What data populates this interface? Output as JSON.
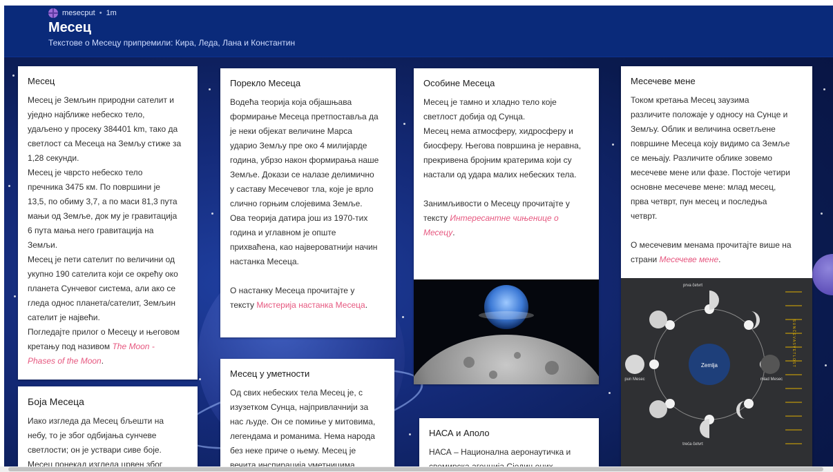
{
  "header": {
    "author": "mesecput",
    "time": "1m",
    "title": "Месец",
    "subtitle": "Текстове о Месецу припремили: Кира, Леда, Лана и Константин"
  },
  "cards": {
    "mesec": {
      "title": "Месец",
      "lines": [
        "Месец је Земљин природни сателит и",
        "уједно најближе небеско тело,",
        "удаљено у просеку 384401 km, тако да",
        "светлост са Месеца на Земљу стиже за",
        "1,28 секунди.",
        "Месец је чврсто небеско тело",
        "пречника 3475 км. По површини је",
        "13,5, по обиму 3,7, а по маси 81,3 пута",
        "мањи од Земље, док му је гравитација",
        "6 пута мања него гравитација на",
        "Земљи.",
        "Месец је пети сателит по величини од",
        "укупно 190 сателита који се окрећу око",
        "планета Сунчевог система, али ако се",
        "гледа однос планета/сателит, Земљин",
        "сателит је највећи.",
        "Погледајте прилог о Месецу и његовом",
        "кретању под називом"
      ],
      "link_a": "The Moon -",
      "link_b": "Phases of the Moon",
      "tail": "."
    },
    "boja": {
      "title": "Боја Месеца",
      "lines": [
        "Иако изгледа да Месец бљешти на",
        "небу, то је због одбијања сунчеве",
        "светлости; он је уствари сиве боје.",
        "Месец понекад изгледа црвен због"
      ]
    },
    "poreklo": {
      "title": "Порекло Месеца",
      "lines": [
        "Водећа теорија која објашњава",
        "формирање Месеца претпоставља да",
        "је неки објекат величине Марса",
        "ударио Земљу пре око 4 милијарде",
        "година, убрзо након формирања наше",
        "Земље. Докази се налазе делимично",
        "у саставу Месечевог тла, које је врло",
        "слично горњим слојевима Земље.",
        "Ова теорија датира још из 1970-тих",
        "година и углавном је опште",
        "прихваћена, као највероватнији начин",
        "настанка Месеца."
      ],
      "more1": "О настанку Месеца прочитајте у",
      "more2": "тексту",
      "link": "Мистерија настанка Месеца",
      "tail": "."
    },
    "umetnost": {
      "title": "Месец у уметности",
      "lines": [
        "Од свих небеских тела Месец је, с",
        "изузетком Сунца, најпривлачнији за",
        "нас људе. Он се помиње у митовима,",
        "легендама и романима. Нема народа",
        "без неке приче о њему. Месец је",
        "вечита инспирација уметницима"
      ]
    },
    "osobine": {
      "title": "Особине Месеца",
      "lines": [
        "Месец је тамно и хладно тело које",
        "светлост добија од Сунца.",
        "Месец нема атмосферу, хидросферу и",
        "биосферу. Његова површина је неравна,",
        "прекривена бројним кратерима који су",
        "настали од удара малих небеских тела."
      ],
      "more1": "Занимљивости о Месецу прочитајте у",
      "more2": "тексту",
      "link_a": "Интересантне чињенице о",
      "link_b": "Месецу",
      "tail": "."
    },
    "nasa": {
      "title": "НАСА и Аполо",
      "lines": [
        "НАСА – Национална аеронаутичка и",
        "свемирска агенција Сједињених"
      ]
    },
    "mene": {
      "title": "Месечеве мене",
      "lines": [
        "Током кретања Месец заузима",
        "различите положаје у односу на Сунце и",
        "Земљу. Облик и величина осветљене",
        "површине Месеца коју видимо са Земље",
        "се мењају. Различите облике зовемо",
        "месечеве мене или фазе. Постоје четири",
        "основне месечеве мене: млад месец,",
        "прва четврт, пун месец и последња",
        "четврт."
      ],
      "more1": "О месечевим менама прочитајте више на",
      "more2": "страни",
      "link": "Месечеве мене",
      "tail": ".",
      "diagram": {
        "center": "Zemlja",
        "top": "prva četvrt",
        "left": "pun Mesec",
        "right": "mlad Mesec",
        "bottom": "treća četvrt",
        "sun": "S U N Č E V A  S V E T L O S T"
      }
    }
  }
}
